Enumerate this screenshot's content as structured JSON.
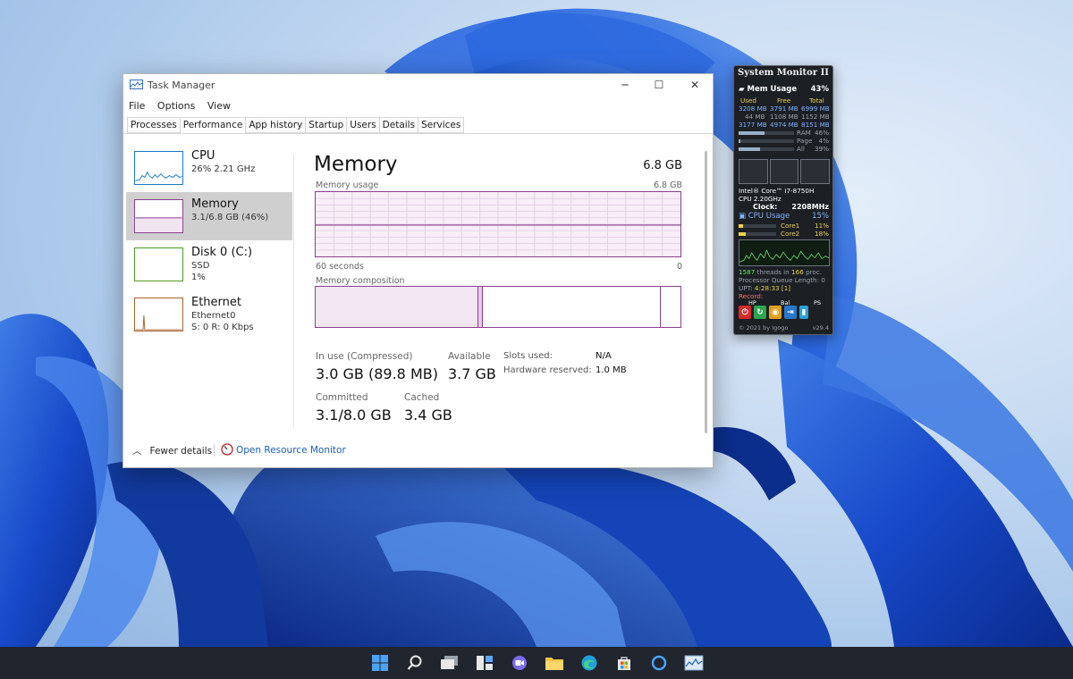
{
  "window": {
    "title": "Task Manager",
    "controls": {
      "minimize": "─",
      "maximize": "☐",
      "close": "✕"
    }
  },
  "menu": [
    "File",
    "Options",
    "View"
  ],
  "tabs": [
    "Processes",
    "Performance",
    "App history",
    "Startup",
    "Users",
    "Details",
    "Services"
  ],
  "active_tab": "Performance",
  "sidebar": {
    "items": [
      {
        "name": "CPU",
        "line1": "26% 2.21 GHz",
        "line2": "",
        "color": "#1a78c2"
      },
      {
        "name": "Memory",
        "line1": "3.1/6.8 GB (46%)",
        "line2": "",
        "color": "#8b3f8f"
      },
      {
        "name": "Disk 0 (C:)",
        "line1": "SSD",
        "line2": "1%",
        "color": "#4d9a1e"
      },
      {
        "name": "Ethernet",
        "line1": "Ethernet0",
        "line2": "S: 0 R: 0 Kbps",
        "color": "#a7622b"
      }
    ]
  },
  "memory": {
    "title": "Memory",
    "total": "6.8 GB",
    "usage_label": "Memory usage",
    "usage_max": "6.8 GB",
    "time_left": "60 seconds",
    "time_right": "0",
    "composition_label": "Memory composition",
    "in_use_fraction": 0.446,
    "modified_fraction": 0.012,
    "stats": {
      "in_use_label": "In use (Compressed)",
      "in_use_value": "3.0 GB (89.8 MB)",
      "available_label": "Available",
      "available_value": "3.7 GB",
      "committed_label": "Committed",
      "committed_value": "3.1/8.0 GB",
      "cached_label": "Cached",
      "cached_value": "3.4 GB",
      "slots_label": "Slots used:",
      "slots_value": "N/A",
      "hw_reserved_label": "Hardware reserved:",
      "hw_reserved_value": "1.0 MB"
    }
  },
  "footer": {
    "fewer_details": "Fewer details",
    "open_resource_monitor": "Open Resource Monitor"
  },
  "system_monitor": {
    "title": "System Monitor II",
    "mem_usage_label": "Mem Usage",
    "mem_usage_value": "43%",
    "col_used": "Used",
    "col_free": "Free",
    "col_total": "Total",
    "row1": [
      "3208 MB",
      "3791 MB",
      "6999 MB"
    ],
    "row2": [
      "44 MB",
      "1108 MB",
      "1152 MB"
    ],
    "row3": [
      "3177 MB",
      "4974 MB",
      "8151 MB"
    ],
    "ram_label": "RAM",
    "ram_value": "46%",
    "ram_fraction": 0.46,
    "page_label": "Page",
    "page_value": "4%",
    "page_fraction": 0.04,
    "all_label": "All",
    "all_value": "39%",
    "all_fraction": 0.39,
    "cpu_name": "Intel® Core™ i7-8750H",
    "cpu_freq": "CPU 2.20GHz",
    "clock_label": "Clock:",
    "clock_value": "2208MHz",
    "cpu_usage_label": "CPU Usage",
    "cpu_usage_value": "15%",
    "core1_label": "Core1",
    "core1_value": "11%",
    "core1_fraction": 0.11,
    "core2_label": "Core2",
    "core2_value": "18%",
    "core2_fraction": 0.18,
    "threads_count": "1587",
    "threads_text": "threads in",
    "proc_count": "166",
    "proc_text": "proc.",
    "queue_text": "Processor Queue Length: 0",
    "upt_label": "UPT:",
    "upt_value": "4:28:33 [1]",
    "record_label": "Record:",
    "btn_labels": [
      "HP",
      "Bal",
      "PS"
    ],
    "footer_left": "© 2021 by Igogo",
    "footer_right": "v29.4"
  },
  "taskbar": {
    "icons": [
      "windows-start-icon",
      "search-icon",
      "task-view-icon",
      "widgets-icon",
      "chat-icon",
      "file-explorer-icon",
      "edge-icon",
      "store-icon",
      "cortana-icon",
      "task-manager-icon"
    ]
  },
  "colors": {
    "memory_accent": "#8b3f8f",
    "taskbar_bg": "#20252e",
    "link": "#1a5fb4"
  }
}
